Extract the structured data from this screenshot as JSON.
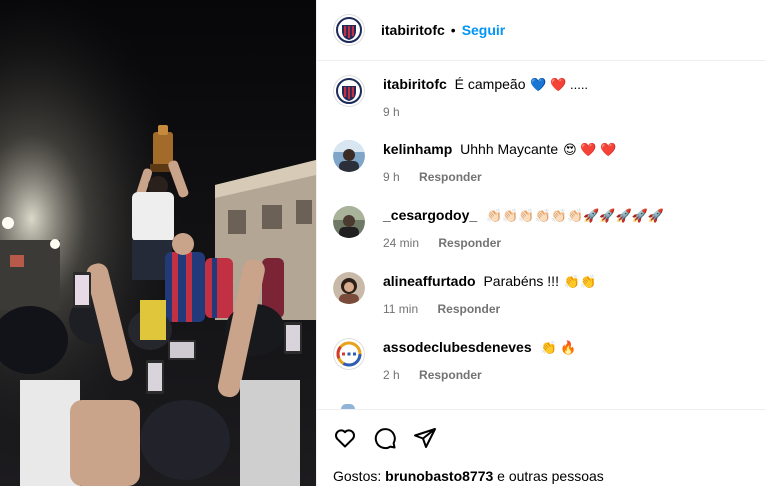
{
  "header": {
    "username": "itabiritofc",
    "separator": "•",
    "follow_label": "Seguir"
  },
  "caption": {
    "username": "itabiritofc",
    "text": "É campeão",
    "emojis": "💙 ❤️ .....",
    "time": "9 h"
  },
  "comments": [
    {
      "username": "kelinhamp",
      "text": "Uhhh Maycante",
      "emojis": "😍 ❤️ ❤️",
      "time": "9 h",
      "reply_label": "Responder"
    },
    {
      "username": "_cesargodoy_",
      "text": "",
      "emojis": "👏🏻👏🏻👏🏻👏🏻👏🏻👏🏻🚀🚀🚀🚀🚀",
      "time": "24 min",
      "reply_label": "Responder"
    },
    {
      "username": "alineaffurtado",
      "text": "Parabéns !!!",
      "emojis": "👏👏",
      "time": "11 min",
      "reply_label": "Responder"
    },
    {
      "username": "assodeclubesdeneves",
      "text": "",
      "emojis": "👏 🔥",
      "time": "2 h",
      "reply_label": "Responder"
    }
  ],
  "likes": {
    "prefix": "Gostos:",
    "who": "brunobasto8773",
    "suffix": "e outras pessoas"
  },
  "icons": {
    "like": "heart-icon",
    "comment": "comment-icon",
    "share": "share-icon"
  },
  "colors": {
    "follow": "#0095f6",
    "meta": "#737373",
    "divider": "#efefef"
  }
}
